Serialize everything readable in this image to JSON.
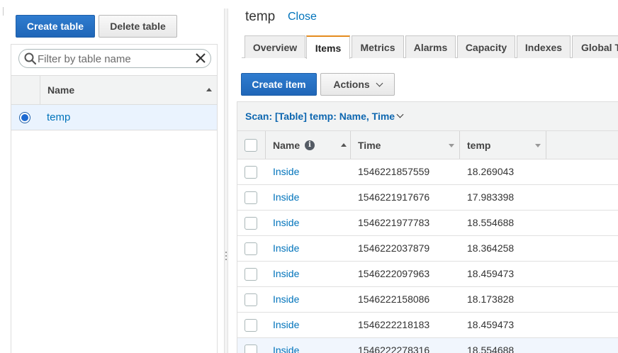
{
  "left": {
    "create_table_label": "Create table",
    "delete_table_label": "Delete table",
    "filter_placeholder": "Filter by table name",
    "column_name": "Name",
    "tables": [
      {
        "name": "temp",
        "selected": true
      }
    ]
  },
  "detail": {
    "title": "temp",
    "close_label": "Close",
    "tabs": [
      {
        "label": "Overview",
        "active": false
      },
      {
        "label": "Items",
        "active": true
      },
      {
        "label": "Metrics",
        "active": false
      },
      {
        "label": "Alarms",
        "active": false
      },
      {
        "label": "Capacity",
        "active": false
      },
      {
        "label": "Indexes",
        "active": false
      },
      {
        "label": "Global T",
        "active": false
      }
    ],
    "create_item_label": "Create item",
    "actions_label": "Actions",
    "scan_label": "Scan: [Table] temp: Name, Time",
    "columns": {
      "name": "Name",
      "time": "Time",
      "temp": "temp"
    },
    "items": [
      {
        "name": "Inside",
        "time": "1546221857559",
        "temp": "18.269043"
      },
      {
        "name": "Inside",
        "time": "1546221917676",
        "temp": "17.983398"
      },
      {
        "name": "Inside",
        "time": "1546221977783",
        "temp": "18.554688"
      },
      {
        "name": "Inside",
        "time": "1546222037879",
        "temp": "18.364258"
      },
      {
        "name": "Inside",
        "time": "1546222097963",
        "temp": "18.459473"
      },
      {
        "name": "Inside",
        "time": "1546222158086",
        "temp": "18.173828"
      },
      {
        "name": "Inside",
        "time": "1546222218183",
        "temp": "18.459473"
      },
      {
        "name": "Inside",
        "time": "1546222278316",
        "temp": "18.554688"
      }
    ]
  },
  "colors": {
    "primary": "#2a73c8",
    "link": "#0073bb",
    "tab_active_accent": "#e58b1e",
    "selected_row": "#eaf3fe"
  }
}
